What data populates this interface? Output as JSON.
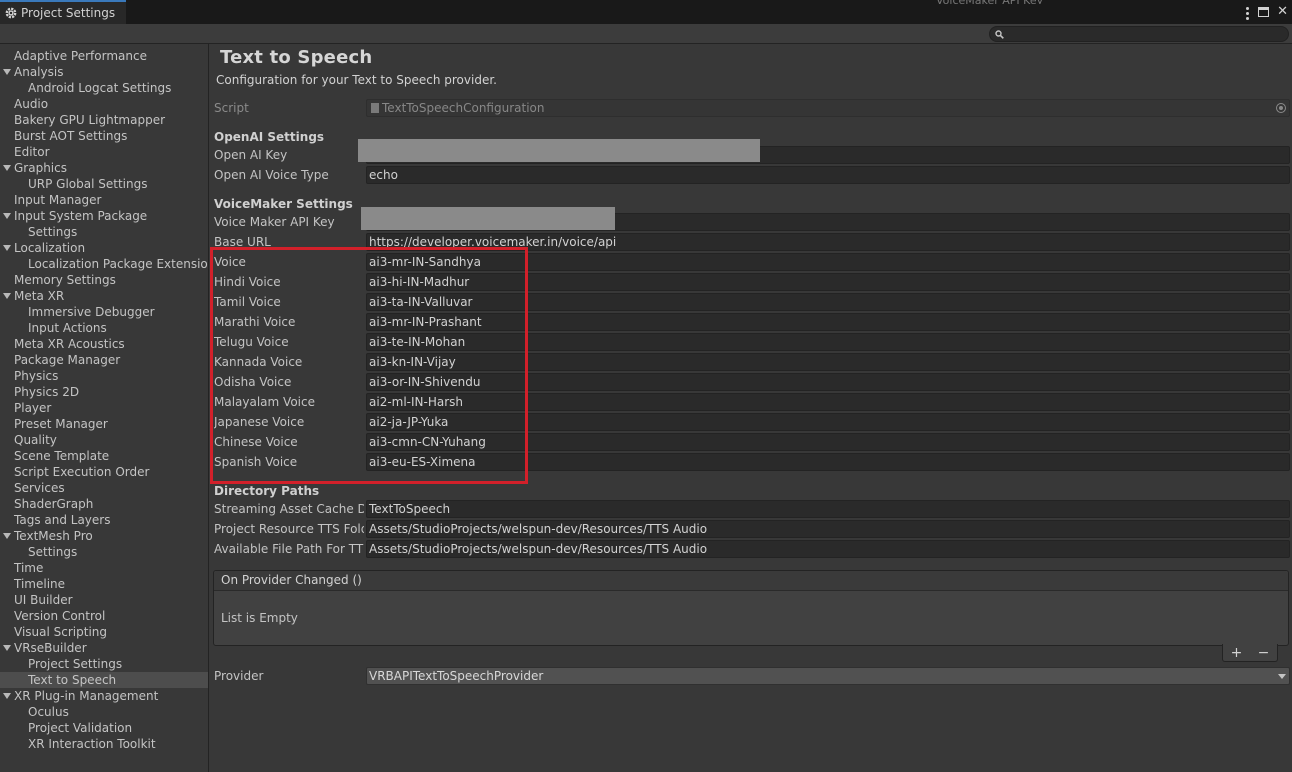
{
  "window": {
    "tab_title": "Project Settings",
    "ghost_tab": "VoiceMaker API Key"
  },
  "sidebar": {
    "items": [
      {
        "label": "Adaptive Performance",
        "level": 0,
        "fold": false
      },
      {
        "label": "Analysis",
        "level": 0,
        "fold": true
      },
      {
        "label": "Android Logcat Settings",
        "level": 1,
        "fold": false
      },
      {
        "label": "Audio",
        "level": 0,
        "fold": false
      },
      {
        "label": "Bakery GPU Lightmapper",
        "level": 0,
        "fold": false
      },
      {
        "label": "Burst AOT Settings",
        "level": 0,
        "fold": false
      },
      {
        "label": "Editor",
        "level": 0,
        "fold": false
      },
      {
        "label": "Graphics",
        "level": 0,
        "fold": true
      },
      {
        "label": "URP Global Settings",
        "level": 1,
        "fold": false
      },
      {
        "label": "Input Manager",
        "level": 0,
        "fold": false
      },
      {
        "label": "Input System Package",
        "level": 0,
        "fold": true
      },
      {
        "label": "Settings",
        "level": 1,
        "fold": false
      },
      {
        "label": "Localization",
        "level": 0,
        "fold": true
      },
      {
        "label": "Localization Package Extension",
        "level": 1,
        "fold": false
      },
      {
        "label": "Memory Settings",
        "level": 0,
        "fold": false
      },
      {
        "label": "Meta XR",
        "level": 0,
        "fold": true
      },
      {
        "label": "Immersive Debugger",
        "level": 1,
        "fold": false
      },
      {
        "label": "Input Actions",
        "level": 1,
        "fold": false
      },
      {
        "label": "Meta XR Acoustics",
        "level": 0,
        "fold": false
      },
      {
        "label": "Package Manager",
        "level": 0,
        "fold": false
      },
      {
        "label": "Physics",
        "level": 0,
        "fold": false
      },
      {
        "label": "Physics 2D",
        "level": 0,
        "fold": false
      },
      {
        "label": "Player",
        "level": 0,
        "fold": false
      },
      {
        "label": "Preset Manager",
        "level": 0,
        "fold": false
      },
      {
        "label": "Quality",
        "level": 0,
        "fold": false
      },
      {
        "label": "Scene Template",
        "level": 0,
        "fold": false
      },
      {
        "label": "Script Execution Order",
        "level": 0,
        "fold": false
      },
      {
        "label": "Services",
        "level": 0,
        "fold": false
      },
      {
        "label": "ShaderGraph",
        "level": 0,
        "fold": false
      },
      {
        "label": "Tags and Layers",
        "level": 0,
        "fold": false
      },
      {
        "label": "TextMesh Pro",
        "level": 0,
        "fold": true
      },
      {
        "label": "Settings",
        "level": 1,
        "fold": false
      },
      {
        "label": "Time",
        "level": 0,
        "fold": false
      },
      {
        "label": "Timeline",
        "level": 0,
        "fold": false
      },
      {
        "label": "UI Builder",
        "level": 0,
        "fold": false
      },
      {
        "label": "Version Control",
        "level": 0,
        "fold": false
      },
      {
        "label": "Visual Scripting",
        "level": 0,
        "fold": false
      },
      {
        "label": "VRseBuilder",
        "level": 0,
        "fold": true
      },
      {
        "label": "Project Settings",
        "level": 1,
        "fold": false
      },
      {
        "label": "Text to Speech",
        "level": 1,
        "fold": false,
        "selected": true
      },
      {
        "label": "XR Plug-in Management",
        "level": 0,
        "fold": true
      },
      {
        "label": "Oculus",
        "level": 1,
        "fold": false
      },
      {
        "label": "Project Validation",
        "level": 1,
        "fold": false
      },
      {
        "label": "XR Interaction Toolkit",
        "level": 1,
        "fold": false
      }
    ]
  },
  "main": {
    "title": "Text to Speech",
    "subtitle": "Configuration for your Text to Speech provider.",
    "script": {
      "label": "Script",
      "value": "TextToSpeechConfiguration"
    },
    "openai": {
      "header": "OpenAI Settings",
      "key_label": "Open AI Key",
      "voice_type_label": "Open AI Voice Type",
      "voice_type_value": "echo"
    },
    "voicemaker": {
      "header": "VoiceMaker Settings",
      "api_key_label": "Voice Maker API Key",
      "base_url_label": "Base URL",
      "base_url_value": "https://developer.voicemaker.in/voice/api",
      "voices": [
        {
          "label": "Voice",
          "value": "ai3-mr-IN-Sandhya"
        },
        {
          "label": "Hindi Voice",
          "value": "ai3-hi-IN-Madhur"
        },
        {
          "label": "Tamil Voice",
          "value": "ai3-ta-IN-Valluvar"
        },
        {
          "label": "Marathi Voice",
          "value": "ai3-mr-IN-Prashant"
        },
        {
          "label": "Telugu Voice",
          "value": "ai3-te-IN-Mohan"
        },
        {
          "label": "Kannada Voice",
          "value": "ai3-kn-IN-Vijay"
        },
        {
          "label": "Odisha Voice",
          "value": "ai3-or-IN-Shivendu"
        },
        {
          "label": "Malayalam Voice",
          "value": "ai2-ml-IN-Harsh"
        },
        {
          "label": "Japanese Voice",
          "value": "ai2-ja-JP-Yuka"
        },
        {
          "label": "Chinese Voice",
          "value": "ai3-cmn-CN-Yuhang"
        },
        {
          "label": "Spanish Voice",
          "value": "ai3-eu-ES-Ximena"
        }
      ]
    },
    "directory": {
      "header": "Directory Paths",
      "rows": [
        {
          "label": "Streaming Asset Cache Directory",
          "value": "TextToSpeech"
        },
        {
          "label": "Project Resource TTS Folder",
          "value": "Assets/StudioProjects/welspun-dev/Resources/TTS Audio"
        },
        {
          "label": "Available File Path For TTS",
          "value": "Assets/StudioProjects/welspun-dev/Resources/TTS Audio"
        }
      ]
    },
    "event": {
      "header": "On Provider Changed ()",
      "empty_text": "List is Empty",
      "add_symbol": "+",
      "remove_symbol": "−"
    },
    "provider": {
      "label": "Provider",
      "value": "VRBAPITextToSpeechProvider"
    }
  },
  "colors": {
    "highlight": "#d2202a",
    "accent": "#3a79bb"
  }
}
